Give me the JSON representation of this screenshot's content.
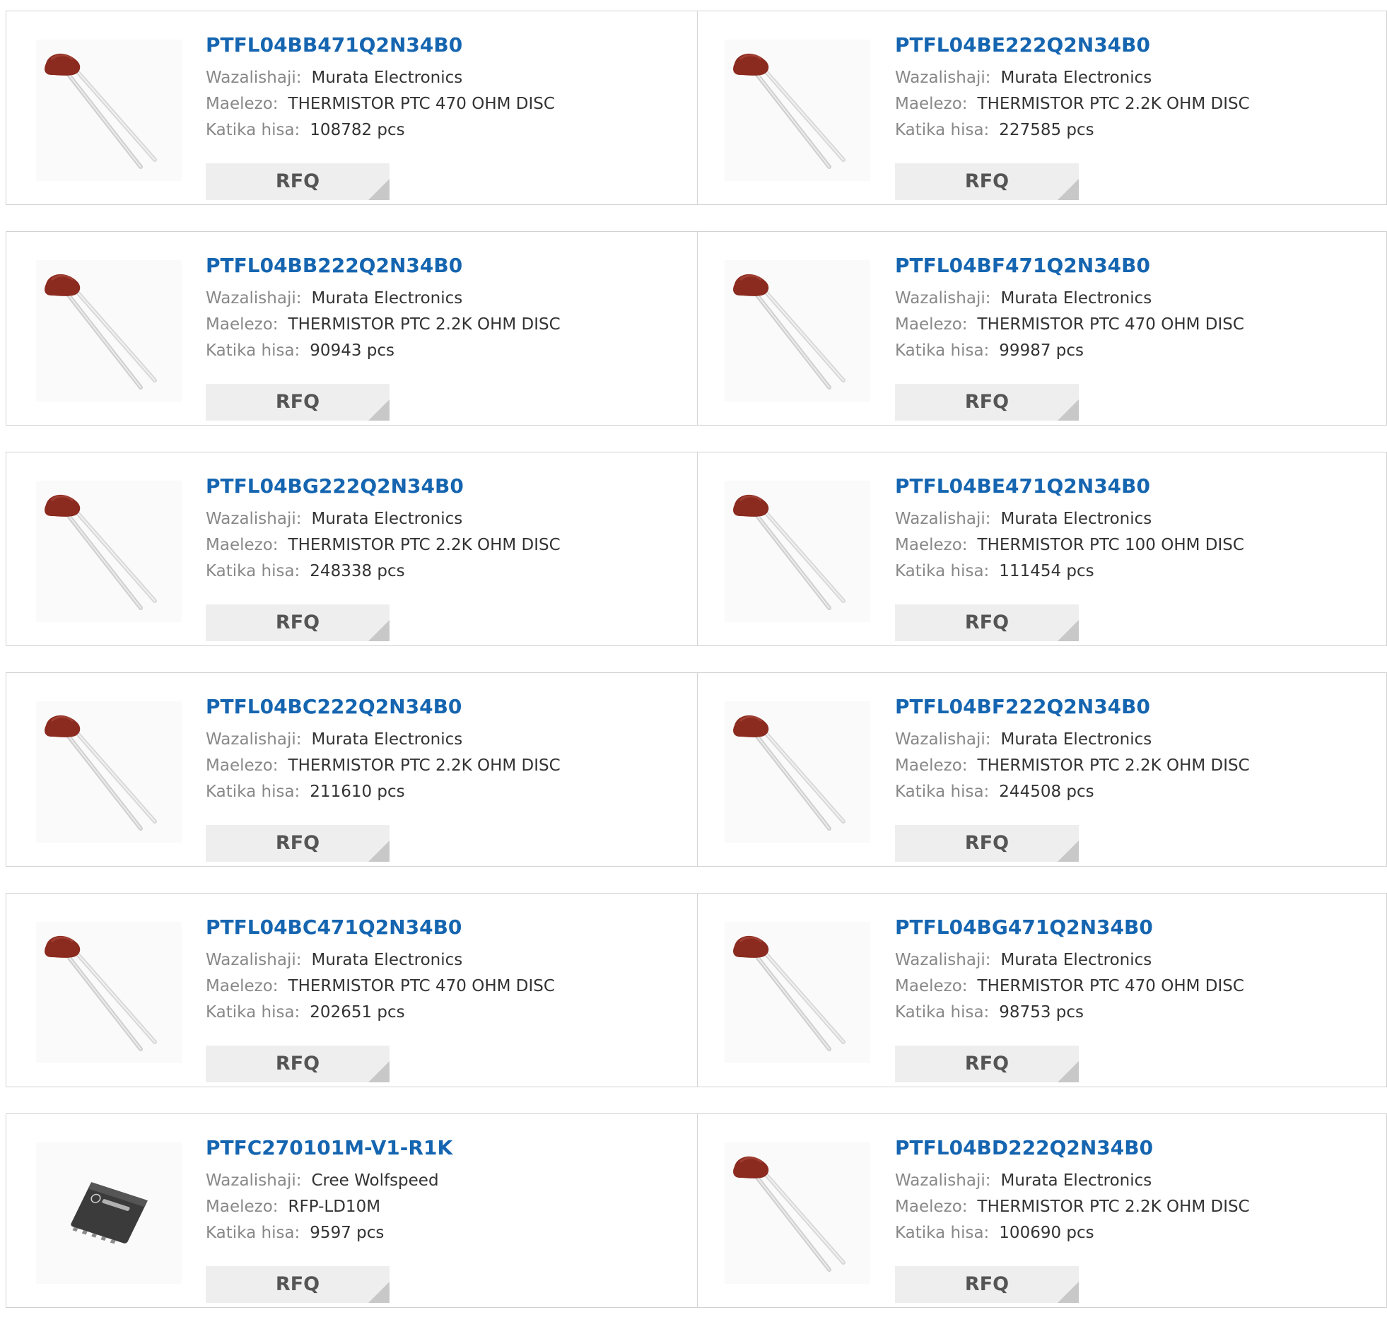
{
  "labels": {
    "manufacturer": "Wazalishaji:",
    "description": "Maelezo:",
    "stock": "Katika hisa:",
    "rfq": "RFQ"
  },
  "colors": {
    "title_link": "#1565b0",
    "thermistor_disc": "#8b2a1f",
    "rfq_bg": "#eeeeee"
  },
  "products": [
    {
      "part": "PTFL04BB471Q2N34B0",
      "manufacturer": "Murata Electronics",
      "description": "THERMISTOR PTC 470 OHM DISC",
      "stock": "108782 pcs",
      "icon": "thermistor-icon"
    },
    {
      "part": "PTFL04BE222Q2N34B0",
      "manufacturer": "Murata Electronics",
      "description": "THERMISTOR PTC 2.2K OHM DISC",
      "stock": "227585 pcs",
      "icon": "thermistor-icon"
    },
    {
      "part": "PTFL04BB222Q2N34B0",
      "manufacturer": "Murata Electronics",
      "description": "THERMISTOR PTC 2.2K OHM DISC",
      "stock": "90943 pcs",
      "icon": "thermistor-icon"
    },
    {
      "part": "PTFL04BF471Q2N34B0",
      "manufacturer": "Murata Electronics",
      "description": "THERMISTOR PTC 470 OHM DISC",
      "stock": "99987 pcs",
      "icon": "thermistor-icon"
    },
    {
      "part": "PTFL04BG222Q2N34B0",
      "manufacturer": "Murata Electronics",
      "description": "THERMISTOR PTC 2.2K OHM DISC",
      "stock": "248338 pcs",
      "icon": "thermistor-icon"
    },
    {
      "part": "PTFL04BE471Q2N34B0",
      "manufacturer": "Murata Electronics",
      "description": "THERMISTOR PTC 100 OHM DISC",
      "stock": "111454 pcs",
      "icon": "thermistor-icon"
    },
    {
      "part": "PTFL04BC222Q2N34B0",
      "manufacturer": "Murata Electronics",
      "description": "THERMISTOR PTC 2.2K OHM DISC",
      "stock": "211610 pcs",
      "icon": "thermistor-icon"
    },
    {
      "part": "PTFL04BF222Q2N34B0",
      "manufacturer": "Murata Electronics",
      "description": "THERMISTOR PTC 2.2K OHM DISC",
      "stock": "244508 pcs",
      "icon": "thermistor-icon"
    },
    {
      "part": "PTFL04BC471Q2N34B0",
      "manufacturer": "Murata Electronics",
      "description": "THERMISTOR PTC 470 OHM DISC",
      "stock": "202651 pcs",
      "icon": "thermistor-icon"
    },
    {
      "part": "PTFL04BG471Q2N34B0",
      "manufacturer": "Murata Electronics",
      "description": "THERMISTOR PTC 470 OHM DISC",
      "stock": "98753 pcs",
      "icon": "thermistor-icon"
    },
    {
      "part": "PTFC270101M-V1-R1K",
      "manufacturer": "Cree Wolfspeed",
      "description": "RFP-LD10M",
      "stock": "9597 pcs",
      "icon": "chip-icon"
    },
    {
      "part": "PTFL04BD222Q2N34B0",
      "manufacturer": "Murata Electronics",
      "description": "THERMISTOR PTC 2.2K OHM DISC",
      "stock": "100690 pcs",
      "icon": "thermistor-icon"
    }
  ]
}
